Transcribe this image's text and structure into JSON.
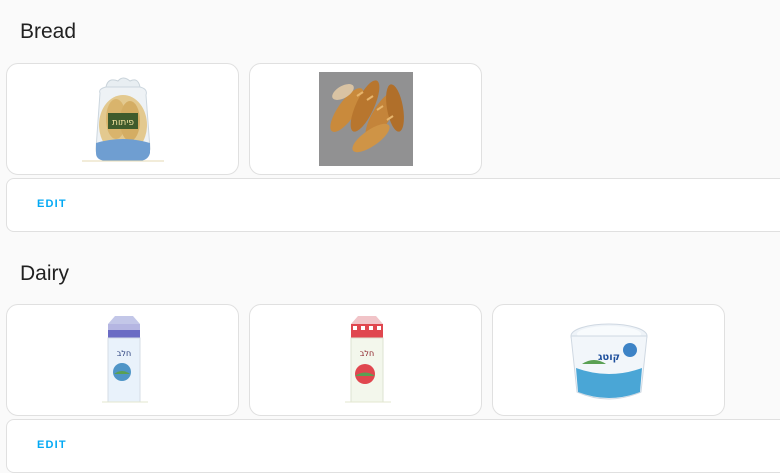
{
  "sections": [
    {
      "title": "Bread",
      "items": [
        {
          "icon": "pita-bag-image",
          "package_text": "פיתות"
        },
        {
          "icon": "baguettes-image"
        }
      ],
      "edit_label": "EDIT"
    },
    {
      "title": "Dairy",
      "items": [
        {
          "icon": "milk-carton-blue-image",
          "package_text": "חלב"
        },
        {
          "icon": "milk-carton-red-image",
          "package_text": "חלב"
        },
        {
          "icon": "cottage-cheese-tub-image",
          "package_text": "קוטג"
        }
      ],
      "edit_label": "EDIT"
    }
  ],
  "colors": {
    "accent": "#03a9f4",
    "background": "#fafafa",
    "card": "#ffffff",
    "border": "#e0e0e0"
  }
}
